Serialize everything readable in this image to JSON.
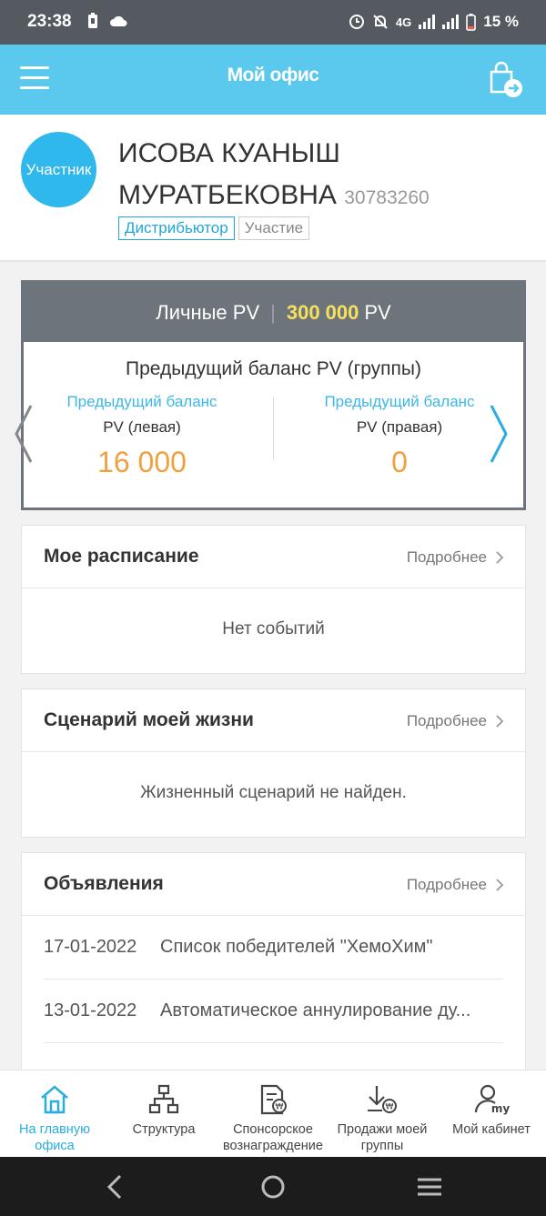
{
  "status_bar": {
    "time": "23:38",
    "network": "4G",
    "battery": "15 %"
  },
  "header": {
    "title": "Мой офис",
    "menu_icon": "hamburger-menu-icon",
    "cart_icon": "cart-exit-icon"
  },
  "profile": {
    "avatar_text": "Участник",
    "name": "ИСОВА КУАНЫШ МУРАТБЕКОВНА",
    "member_id": "30783260",
    "badges": [
      "Дистрибьютор",
      "Участие"
    ]
  },
  "pv": {
    "personal_label": "Личные PV",
    "personal_value": "300 000",
    "unit": "PV",
    "group_title": "Предыдущий баланс PV (группы)",
    "left": {
      "label1": "Предыдущий баланс",
      "label2": "PV (левая)",
      "value": "16 000"
    },
    "right": {
      "label1": "Предыдущий баланс",
      "label2": "PV (правая)",
      "value": "0"
    }
  },
  "schedule": {
    "title": "Мое расписание",
    "more": "Подробнее",
    "empty": "Нет событий"
  },
  "life_scenario": {
    "title": "Сценарий моей жизни",
    "more": "Подробнее",
    "empty": "Жизненный сценарий не найден."
  },
  "announcements": {
    "title": "Объявления",
    "more": "Подробнее",
    "items": [
      {
        "date": "17-01-2022",
        "text": "Список победителей \"ХемоХим\""
      },
      {
        "date": "13-01-2022",
        "text": "Автоматическое аннулирование ду..."
      }
    ]
  },
  "bottom_nav": [
    {
      "label": "На главную офиса",
      "icon": "home-icon",
      "active": true
    },
    {
      "label": "Структура",
      "icon": "structure-icon",
      "active": false
    },
    {
      "label": "Спонсорское вознаграждение",
      "icon": "sponsor-reward-icon",
      "active": false
    },
    {
      "label": "Продажи моей группы",
      "icon": "group-sales-icon",
      "active": false
    },
    {
      "label": "Мой кабинет",
      "icon": "my-account-icon",
      "active": false
    }
  ],
  "colors": {
    "accent": "#5bc8ee",
    "header_grey": "#6e747c",
    "pv_highlight": "#f8e15a",
    "value_orange": "#f0a03c",
    "link_blue": "#3db7e6"
  }
}
